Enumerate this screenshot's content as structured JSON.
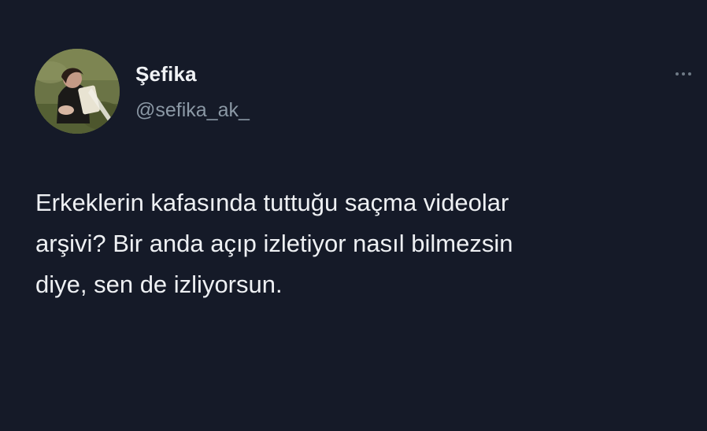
{
  "author": {
    "display_name": "Şefika",
    "handle": "@sefika_ak_"
  },
  "icons": {
    "more": "more-horizontal-icon",
    "avatar": "profile-photo"
  },
  "tweet": {
    "lines": [
      "Erkeklerin kafasında tuttuğu saçma videolar",
      "arşivi? Bir anda açıp izletiyor nasıl bilmezsin",
      "diye, sen de izliyorsun."
    ]
  },
  "colors": {
    "background": "#151a28",
    "text": "#eef0f3",
    "secondary_text": "#8b98a5"
  }
}
